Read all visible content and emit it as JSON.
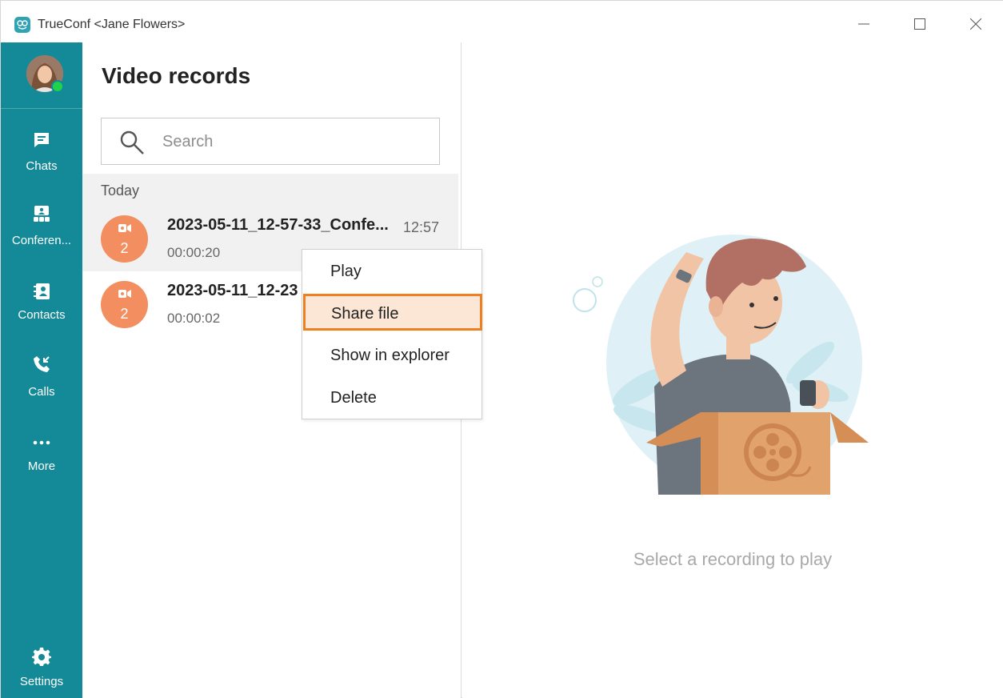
{
  "window": {
    "title": "TrueConf <Jane Flowers>"
  },
  "sidebar": {
    "items": [
      {
        "label": "Chats",
        "icon": "chat-icon"
      },
      {
        "label": "Conferen...",
        "icon": "conference-icon"
      },
      {
        "label": "Contacts",
        "icon": "contacts-icon"
      },
      {
        "label": "Calls",
        "icon": "calls-icon"
      },
      {
        "label": "More",
        "icon": "more-icon"
      },
      {
        "label": "Settings",
        "icon": "gear-icon"
      }
    ],
    "presence": "online"
  },
  "list": {
    "title": "Video records",
    "search": {
      "placeholder": "Search",
      "value": ""
    },
    "section": "Today",
    "records": [
      {
        "name": "2023-05-11_12-57-33_Confe...",
        "time": "12:57",
        "duration": "00:00:20",
        "count": "2",
        "selected": true
      },
      {
        "name": "2023-05-11_12-23",
        "time": "",
        "duration": "00:00:02",
        "count": "2",
        "selected": false
      }
    ]
  },
  "context_menu": {
    "items": [
      "Play",
      "Share file",
      "Show in explorer",
      "Delete"
    ],
    "highlighted": "Share file"
  },
  "content": {
    "empty_text": "Select a recording to play"
  },
  "colors": {
    "sidebar": "#148a98",
    "avatar": "#f28e5f",
    "highlight_border": "#f07f22",
    "highlight_fill": "#fce6d6",
    "presence": "#1fd34b"
  }
}
